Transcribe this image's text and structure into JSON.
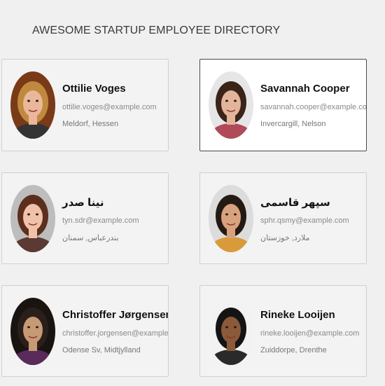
{
  "page": {
    "title": "AWESOME STARTUP EMPLOYEE DIRECTORY"
  },
  "employees": [
    {
      "name": "Ottilie Voges",
      "email": "ottilie.voges@example.com",
      "location": "Meldorf, Hessen",
      "avatar_colors": {
        "bg": "#7a3a18",
        "hair": "#c08a3e",
        "skin": "#eab79a",
        "shirt": "#333333"
      }
    },
    {
      "name": "Savannah Cooper",
      "email": "savannah.cooper@example.com",
      "location": "Invercargill, Nelson",
      "avatar_colors": {
        "bg": "#e6e6e6",
        "hair": "#3a2418",
        "skin": "#e2b59b",
        "shirt": "#b04a5a"
      }
    },
    {
      "name": "نينا صدر",
      "email": "tyn.sdr@example.com",
      "location": "بندرعباس, سمنان",
      "avatar_colors": {
        "bg": "#bdbdbd",
        "hair": "#5c2e1e",
        "skin": "#f0c2aa",
        "shirt": "#5a3a32"
      }
    },
    {
      "name": "سپهر قاسمی",
      "email": "sphr.qsmy@example.com",
      "location": "ملارد, خوزستان",
      "avatar_colors": {
        "bg": "#dcdcdc",
        "hair": "#241a14",
        "skin": "#d8a27f",
        "shirt": "#d99a3a"
      }
    },
    {
      "name": "Christoffer Jørgensen",
      "email": "christoffer.jorgensen@example.com",
      "location": "Odense Sv, Midtjylland",
      "avatar_colors": {
        "bg": "#1a1410",
        "hair": "#2a1f1a",
        "skin": "#c69a74",
        "shirt": "#5a2a5a"
      }
    },
    {
      "name": "Rineke Looijen",
      "email": "rineke.looijen@example.com",
      "location": "Zuiddorpe, Drenthe",
      "avatar_colors": {
        "bg": "#f2f2f2",
        "hair": "#141414",
        "skin": "#8a5a3a",
        "shirt": "#2a2a2a"
      }
    }
  ]
}
